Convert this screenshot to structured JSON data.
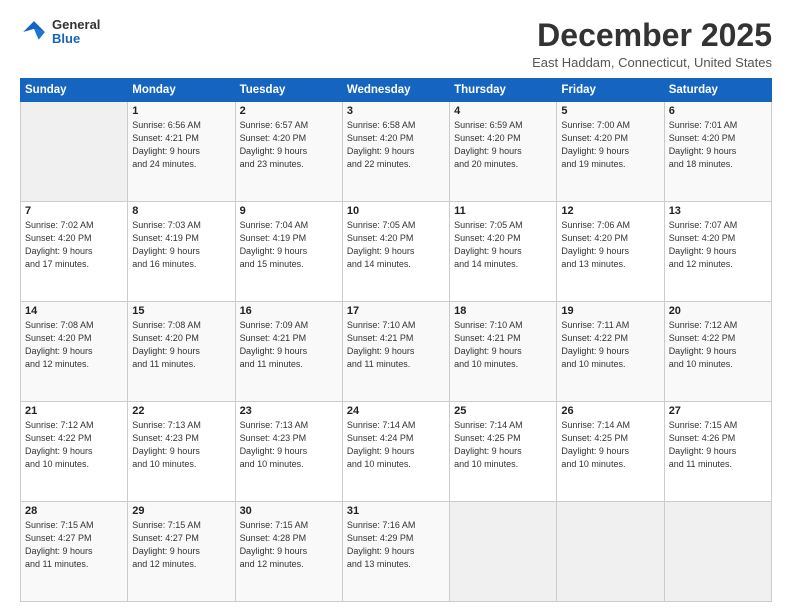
{
  "header": {
    "logo_general": "General",
    "logo_blue": "Blue",
    "month_title": "December 2025",
    "location": "East Haddam, Connecticut, United States"
  },
  "weekdays": [
    "Sunday",
    "Monday",
    "Tuesday",
    "Wednesday",
    "Thursday",
    "Friday",
    "Saturday"
  ],
  "weeks": [
    [
      {
        "day": "",
        "info": ""
      },
      {
        "day": "1",
        "info": "Sunrise: 6:56 AM\nSunset: 4:21 PM\nDaylight: 9 hours\nand 24 minutes."
      },
      {
        "day": "2",
        "info": "Sunrise: 6:57 AM\nSunset: 4:20 PM\nDaylight: 9 hours\nand 23 minutes."
      },
      {
        "day": "3",
        "info": "Sunrise: 6:58 AM\nSunset: 4:20 PM\nDaylight: 9 hours\nand 22 minutes."
      },
      {
        "day": "4",
        "info": "Sunrise: 6:59 AM\nSunset: 4:20 PM\nDaylight: 9 hours\nand 20 minutes."
      },
      {
        "day": "5",
        "info": "Sunrise: 7:00 AM\nSunset: 4:20 PM\nDaylight: 9 hours\nand 19 minutes."
      },
      {
        "day": "6",
        "info": "Sunrise: 7:01 AM\nSunset: 4:20 PM\nDaylight: 9 hours\nand 18 minutes."
      }
    ],
    [
      {
        "day": "7",
        "info": "Sunrise: 7:02 AM\nSunset: 4:20 PM\nDaylight: 9 hours\nand 17 minutes."
      },
      {
        "day": "8",
        "info": "Sunrise: 7:03 AM\nSunset: 4:19 PM\nDaylight: 9 hours\nand 16 minutes."
      },
      {
        "day": "9",
        "info": "Sunrise: 7:04 AM\nSunset: 4:19 PM\nDaylight: 9 hours\nand 15 minutes."
      },
      {
        "day": "10",
        "info": "Sunrise: 7:05 AM\nSunset: 4:20 PM\nDaylight: 9 hours\nand 14 minutes."
      },
      {
        "day": "11",
        "info": "Sunrise: 7:05 AM\nSunset: 4:20 PM\nDaylight: 9 hours\nand 14 minutes."
      },
      {
        "day": "12",
        "info": "Sunrise: 7:06 AM\nSunset: 4:20 PM\nDaylight: 9 hours\nand 13 minutes."
      },
      {
        "day": "13",
        "info": "Sunrise: 7:07 AM\nSunset: 4:20 PM\nDaylight: 9 hours\nand 12 minutes."
      }
    ],
    [
      {
        "day": "14",
        "info": "Sunrise: 7:08 AM\nSunset: 4:20 PM\nDaylight: 9 hours\nand 12 minutes."
      },
      {
        "day": "15",
        "info": "Sunrise: 7:08 AM\nSunset: 4:20 PM\nDaylight: 9 hours\nand 11 minutes."
      },
      {
        "day": "16",
        "info": "Sunrise: 7:09 AM\nSunset: 4:21 PM\nDaylight: 9 hours\nand 11 minutes."
      },
      {
        "day": "17",
        "info": "Sunrise: 7:10 AM\nSunset: 4:21 PM\nDaylight: 9 hours\nand 11 minutes."
      },
      {
        "day": "18",
        "info": "Sunrise: 7:10 AM\nSunset: 4:21 PM\nDaylight: 9 hours\nand 10 minutes."
      },
      {
        "day": "19",
        "info": "Sunrise: 7:11 AM\nSunset: 4:22 PM\nDaylight: 9 hours\nand 10 minutes."
      },
      {
        "day": "20",
        "info": "Sunrise: 7:12 AM\nSunset: 4:22 PM\nDaylight: 9 hours\nand 10 minutes."
      }
    ],
    [
      {
        "day": "21",
        "info": "Sunrise: 7:12 AM\nSunset: 4:22 PM\nDaylight: 9 hours\nand 10 minutes."
      },
      {
        "day": "22",
        "info": "Sunrise: 7:13 AM\nSunset: 4:23 PM\nDaylight: 9 hours\nand 10 minutes."
      },
      {
        "day": "23",
        "info": "Sunrise: 7:13 AM\nSunset: 4:23 PM\nDaylight: 9 hours\nand 10 minutes."
      },
      {
        "day": "24",
        "info": "Sunrise: 7:14 AM\nSunset: 4:24 PM\nDaylight: 9 hours\nand 10 minutes."
      },
      {
        "day": "25",
        "info": "Sunrise: 7:14 AM\nSunset: 4:25 PM\nDaylight: 9 hours\nand 10 minutes."
      },
      {
        "day": "26",
        "info": "Sunrise: 7:14 AM\nSunset: 4:25 PM\nDaylight: 9 hours\nand 10 minutes."
      },
      {
        "day": "27",
        "info": "Sunrise: 7:15 AM\nSunset: 4:26 PM\nDaylight: 9 hours\nand 11 minutes."
      }
    ],
    [
      {
        "day": "28",
        "info": "Sunrise: 7:15 AM\nSunset: 4:27 PM\nDaylight: 9 hours\nand 11 minutes."
      },
      {
        "day": "29",
        "info": "Sunrise: 7:15 AM\nSunset: 4:27 PM\nDaylight: 9 hours\nand 12 minutes."
      },
      {
        "day": "30",
        "info": "Sunrise: 7:15 AM\nSunset: 4:28 PM\nDaylight: 9 hours\nand 12 minutes."
      },
      {
        "day": "31",
        "info": "Sunrise: 7:16 AM\nSunset: 4:29 PM\nDaylight: 9 hours\nand 13 minutes."
      },
      {
        "day": "",
        "info": ""
      },
      {
        "day": "",
        "info": ""
      },
      {
        "day": "",
        "info": ""
      }
    ]
  ]
}
